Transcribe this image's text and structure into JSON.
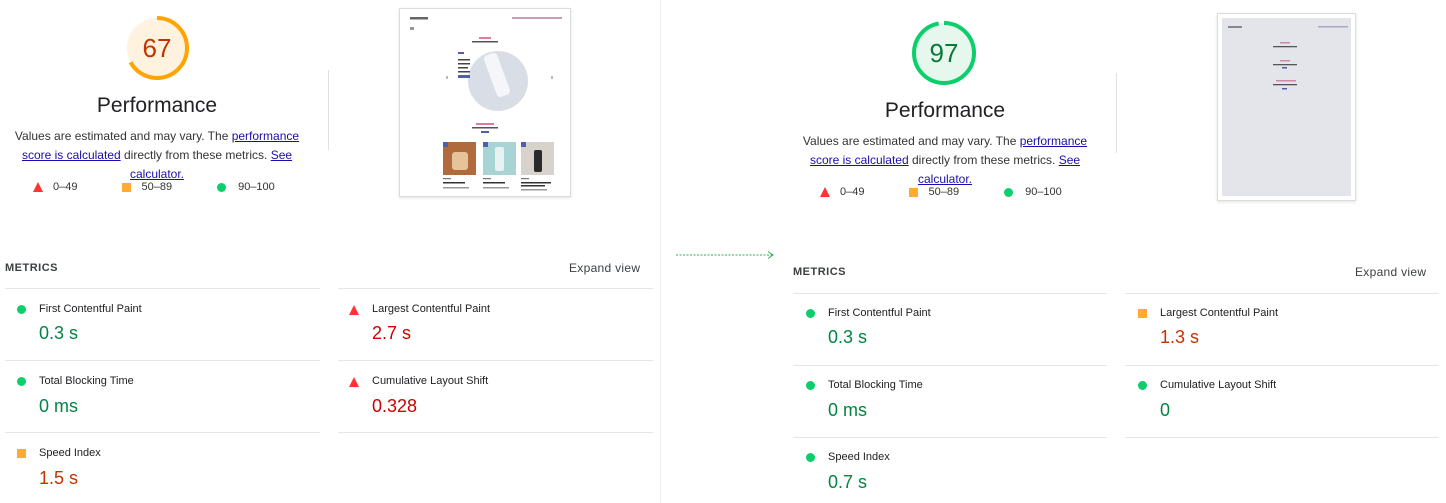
{
  "left": {
    "score": "67",
    "title": "Performance",
    "desc_prefix": "Values are estimated and may vary. The ",
    "desc_link": "performance score is calculated",
    "desc_middle": " directly from these metrics. ",
    "desc_calc": "See calculator.",
    "legend": {
      "fail": "0–49",
      "average": "50–89",
      "pass": "90–100"
    },
    "metrics_label": "METRICS",
    "expand_label": "Expand view",
    "metrics": {
      "fcp": {
        "label": "First Contentful Paint",
        "value": "0.3 s"
      },
      "lcp": {
        "label": "Largest Contentful Paint",
        "value": "2.7 s"
      },
      "tbt": {
        "label": "Total Blocking Time",
        "value": "0 ms"
      },
      "cls": {
        "label": "Cumulative Layout Shift",
        "value": "0.328"
      },
      "si": {
        "label": "Speed Index",
        "value": "1.5 s"
      }
    }
  },
  "right": {
    "score": "97",
    "title": "Performance",
    "desc_prefix": "Values are estimated and may vary. The ",
    "desc_link": "performance score is calculated",
    "desc_middle": " directly from these metrics. ",
    "desc_calc": "See calculator.",
    "legend": {
      "fail": "0–49",
      "average": "50–89",
      "pass": "90–100"
    },
    "metrics_label": "METRICS",
    "expand_label": "Expand view",
    "metrics": {
      "fcp": {
        "label": "First Contentful Paint",
        "value": "0.3 s"
      },
      "lcp": {
        "label": "Largest Contentful Paint",
        "value": "1.3 s"
      },
      "tbt": {
        "label": "Total Blocking Time",
        "value": "0 ms"
      },
      "cls": {
        "label": "Cumulative Layout Shift",
        "value": "0"
      },
      "si": {
        "label": "Speed Index",
        "value": "0.7 s"
      }
    }
  },
  "colors": {
    "fail": "#ff3333",
    "average": "#ffaa33",
    "pass": "#0cce6b",
    "good_text": "#018642",
    "avg_text": "#c33300",
    "bad_text": "#cc0000"
  }
}
